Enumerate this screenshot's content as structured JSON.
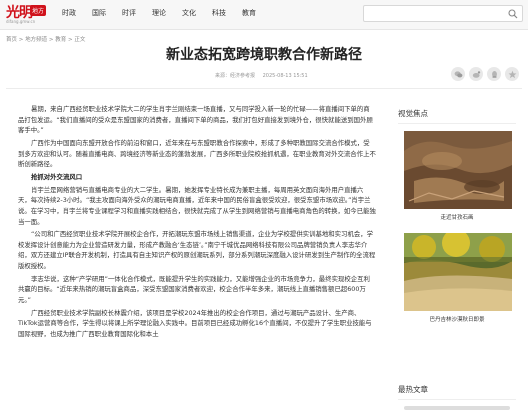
{
  "site": {
    "logo_text": "光明",
    "logo_tag": "地方",
    "logo_sub": "difang.gmw.cn"
  },
  "nav": [
    "时政",
    "国际",
    "时评",
    "理论",
    "文化",
    "科技",
    "教育"
  ],
  "search": {
    "placeholder": ""
  },
  "breadcrumb": "首页 > 地方频道 > 教育 > 正文",
  "article": {
    "title": "新业态拓宽跨境职教合作新路径",
    "source": "来源：经济参考报",
    "date": "2025-08-13 15:51",
    "paragraphs": [
      "暑期，来自广西经贸职业技术学院大二的学生肖宇兰刚结束一场直播，又与同学投入新一轮的忙碌——将直播间下单的商品打包发运。“我们直播间的受众是东盟国家的消费者，直播间下单的商品，我们打包好直接发到境外仓，很快就能送到国外顾客手中。”",
      "广西作为中国面向东盟开放合作的前沿和窗口，近年来在与东盟职教合作探索中，形成了多种职教国际交流合作模式，受到多方欢迎和认可。随着直播电商、跨境经济等新业态的蓬勃发展，广西多所职业院校抢抓机遇，在职业教育对外交流合作上不断创新路径。",
      "抢抓对外交流风口",
      "肖宇兰是网络营销与直播电商专业的大二学生。暑期，她发挥专业特长成为兼职主播，每周用英文面向海外用户直播六天，每次持续2-3小时。“我主攻面向海外受众的潮玩电商直播，近年来中国的民俗盲盒很受欢迎，很受东盟市场欢迎。”肖宇兰说。在学习中，肖宇兰将专业课程学习和直播实践相结合，很快就完成了从学生到网络营销与直播电商角色的转换，如今已能独当一面。",
      "“公司和广西经贸职业技术学院开展校企合作，开拓潮玩东盟市场线上销售渠道，企业为学校提供实训基地和实习机会，学校发挥设计创意能力为企业营造研发力量，形成产教融合‘生态链’。”南宁千城优品网络科技有限公司品牌营销负责人李志华介绍，双方还建立IP联合开发机制，打造具有自主知识产权的原创潮玩系列，部分系列潮玩深度融入设计研发到生产制作的全流程版权授权。",
      "李志华说，这种“产学研用”一体化合作模式，既能提升学生的实践能力，又能增强企业的市场竞争力，最终实现校企互利共赢的目标。“近年来热销的潮玩盲盒商品，深受东盟国家消费者欢迎，校企合作半年多来，潮玩线上直播销售额已超600万元。”",
      "广西经贸职业技术学院副校长林震介绍，该项目是学校2024年推出的校企合作项目，通过与潮玩产品设计、生产商、TikTok运营商等合作，学生得以将课上所学理论融入实践中。目前项目已经成功孵化16个直播间，不仅提升了学生职业技能与国际视野，也成为推广广西职业教育国际化和本土"
    ]
  },
  "sidebar": {
    "video_heading": "视觉焦点",
    "items": [
      {
        "caption": "走近甘孜石画"
      },
      {
        "caption": "巴丹吉林沙漠秋日即景"
      }
    ],
    "latest_heading": "最热文章"
  },
  "colors": {
    "brand_red": "#d0121b",
    "topbar_bg": "#f7f7f7"
  }
}
